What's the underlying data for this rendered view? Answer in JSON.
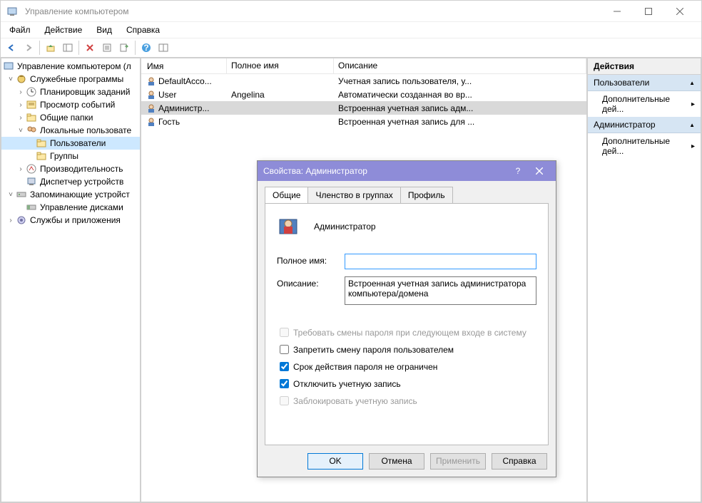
{
  "window": {
    "title": "Управление компьютером"
  },
  "menu": {
    "file": "Файл",
    "action": "Действие",
    "view": "Вид",
    "help": "Справка"
  },
  "tree": {
    "root": "Управление компьютером (л",
    "services": "Служебные программы",
    "scheduler": "Планировщик заданий",
    "eventviewer": "Просмотр событий",
    "sharedfolders": "Общие папки",
    "localusers": "Локальные пользовате",
    "users": "Пользователи",
    "groups": "Группы",
    "performance": "Производительность",
    "devicemgr": "Диспетчер устройств",
    "storage": "Запоминающие устройст",
    "diskmgmt": "Управление дисками",
    "servicesapps": "Службы и приложения"
  },
  "list": {
    "col_name": "Имя",
    "col_fullname": "Полное имя",
    "col_desc": "Описание",
    "rows": [
      {
        "name": "DefaultAcco...",
        "fullname": "",
        "desc": "Учетная запись пользователя, у..."
      },
      {
        "name": "User",
        "fullname": "Angelina",
        "desc": "Автоматически созданная во вр..."
      },
      {
        "name": "Администр...",
        "fullname": "",
        "desc": "Встроенная учетная запись адм..."
      },
      {
        "name": "Гость",
        "fullname": "",
        "desc": "Встроенная учетная запись для ..."
      }
    ]
  },
  "actions": {
    "header": "Действия",
    "section1": "Пользователи",
    "more1": "Дополнительные дей...",
    "section2": "Администратор",
    "more2": "Дополнительные дей..."
  },
  "dialog": {
    "title": "Свойства: Администратор",
    "tab_general": "Общие",
    "tab_memberof": "Членство в группах",
    "tab_profile": "Профиль",
    "username": "Администратор",
    "lbl_fullname": "Полное имя:",
    "lbl_desc": "Описание:",
    "val_fullname": "",
    "val_desc": "Встроенная учетная запись администратора компьютера/домена",
    "chk_mustchange": "Требовать смены пароля при следующем входе в систему",
    "chk_cantchange": "Запретить смену пароля пользователем",
    "chk_neverexpires": "Срок действия пароля не ограничен",
    "chk_disabled": "Отключить учетную запись",
    "chk_locked": "Заблокировать учетную запись",
    "btn_ok": "OK",
    "btn_cancel": "Отмена",
    "btn_apply": "Применить",
    "btn_help": "Справка"
  }
}
